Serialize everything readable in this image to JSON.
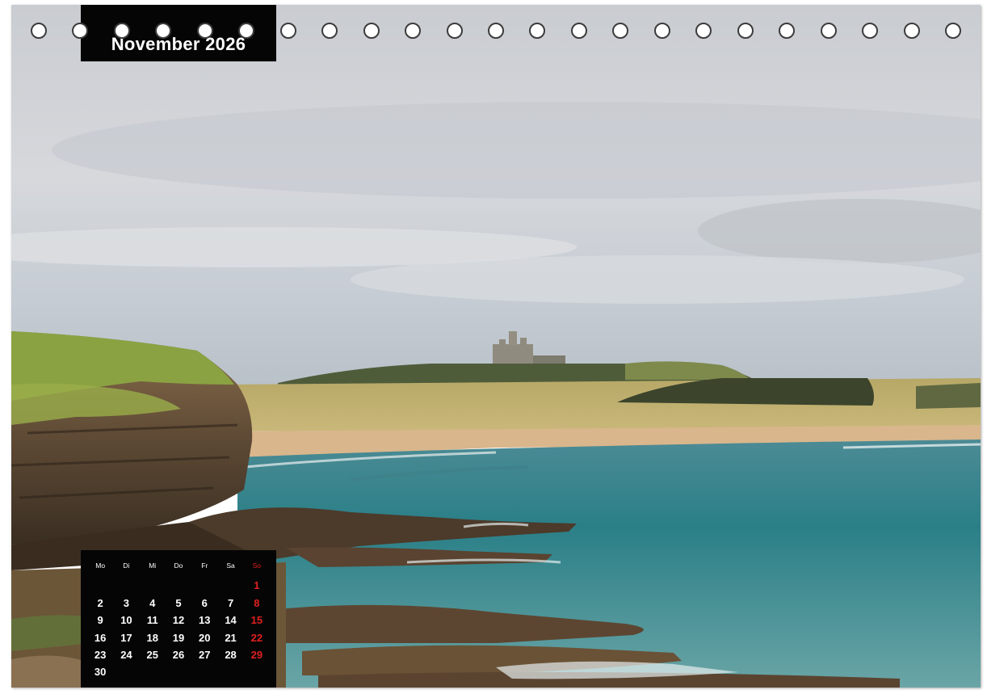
{
  "calendar": {
    "month_title": "November 2026",
    "weekdays": [
      "Mo",
      "Di",
      "Mi",
      "Do",
      "Fr",
      "Sa",
      "So"
    ],
    "weeks": [
      [
        "",
        "",
        "",
        "",
        "",
        "",
        "1"
      ],
      [
        "2",
        "3",
        "4",
        "5",
        "6",
        "7",
        "8"
      ],
      [
        "9",
        "10",
        "11",
        "12",
        "13",
        "14",
        "15"
      ],
      [
        "16",
        "17",
        "18",
        "19",
        "20",
        "21",
        "22"
      ],
      [
        "23",
        "24",
        "25",
        "26",
        "27",
        "28",
        "29"
      ],
      [
        "30",
        "",
        "",
        "",
        "",
        "",
        ""
      ]
    ]
  },
  "binding": {
    "ring_count": 23
  },
  "colors": {
    "sunday": "#e02020",
    "panel": "#050505",
    "sky": "#cfd3d8",
    "sea": "#2f8a90",
    "sand": "#d9b68c",
    "grass": "#a9a44a"
  }
}
